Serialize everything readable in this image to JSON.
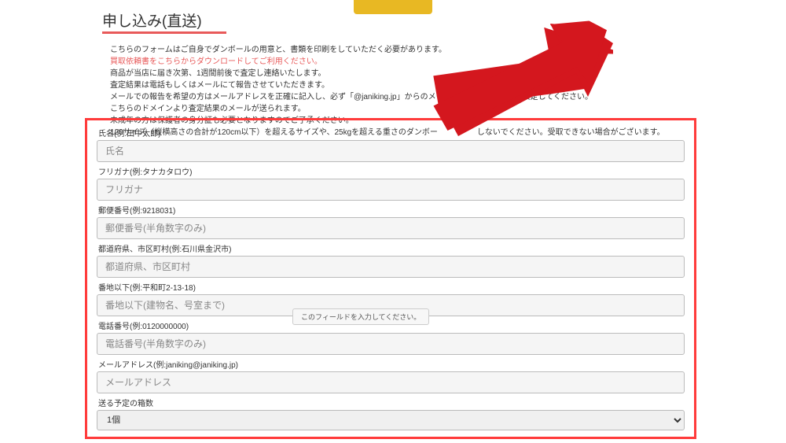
{
  "header": {
    "title": "申し込み(直送)"
  },
  "description": {
    "line1": "こちらのフォームはご自身でダンボールの用意と、書類を印刷をしていただく必要があります。",
    "line2_link": "買取依頼書をこちらからダウンロードしてご利用ください。",
    "line3": "商品が当店に届き次第、1週間前後で査定し連絡いたします。",
    "line4": "査定結果は電話もしくはメールにて報告させていただきます。",
    "line5": "メールでの報告を希望の方はメールアドレスを正確に記入し、必ず「@janiking.jp」からのメールを受信でき　　　　設定してください。",
    "line6": "こちらのドメインより査定結果のメールが送られます。",
    "line7": "未成年の方は保護者の身分証も必要となりますのでご了承ください。",
    "line8": "120サイズ（縦横高さの合計が120cm以下）を超えるサイズや、25kgを超える重さのダンボー　　　　　しないでください。受取できない場合がございます。"
  },
  "form": {
    "name": {
      "label": "氏名(例:田中太郎)",
      "placeholder": "氏名"
    },
    "furigana": {
      "label": "フリガナ(例:タナカタロウ)",
      "placeholder": "フリガナ"
    },
    "postal": {
      "label": "郵便番号(例:9218031)",
      "placeholder": "郵便番号(半角数字のみ)"
    },
    "prefecture": {
      "label": "都道府県、市区町村(例:石川県金沢市)",
      "placeholder": "都道府県、市区町村"
    },
    "address": {
      "label": "番地以下(例:平和町2-13-18)",
      "placeholder": "番地以下(建物名、号室まで)"
    },
    "phone": {
      "label": "電話番号(例:0120000000)",
      "placeholder": "電話番号(半角数字のみ)"
    },
    "email": {
      "label": "メールアドレス(例:janiking@janiking.jp)",
      "placeholder": "メールアドレス"
    },
    "boxes": {
      "label": "送る予定の箱数",
      "selected": "1個"
    }
  },
  "tooltip": {
    "text": "このフィールドを入力してください。"
  }
}
